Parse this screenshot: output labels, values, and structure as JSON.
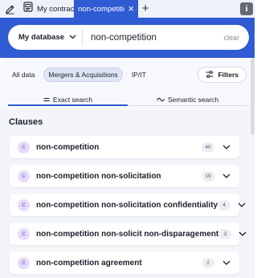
{
  "tabs": {
    "edit_icon": "pencil-icon",
    "contract_icon": "document-icon",
    "contract_label": "My contract",
    "active_label": "non-competitio",
    "info_label": "i"
  },
  "search": {
    "database_label": "My database",
    "query": "non-competition",
    "clear_label": "clear"
  },
  "filters": {
    "chips": [
      "All data",
      "Mergers & Acquisitions",
      "IP/IT"
    ],
    "active_chip": "Mergers & Acquisitions",
    "filters_label": "Filters"
  },
  "search_modes": {
    "exact_label": "Exact search",
    "semantic_label": "Semantic search",
    "active": "Exact search"
  },
  "clauses": {
    "title": "Clauses",
    "items": [
      {
        "badge": "C",
        "term": "non-competition",
        "count": "40"
      },
      {
        "badge": "C",
        "term": "non-competition non-solicitation",
        "count": "19"
      },
      {
        "badge": "C",
        "term": "non-competition non-solicitation confidentiality",
        "count": "4"
      },
      {
        "badge": "C",
        "term": "non-competition non-solicit non-disparagement",
        "count": "3"
      },
      {
        "badge": "C",
        "term": "non-competition agreement",
        "count": "2"
      }
    ]
  },
  "colors": {
    "brand_blue": "#2f5bd3",
    "badge_bg": "#e6dcfa",
    "badge_fg": "#5b3fb3"
  }
}
